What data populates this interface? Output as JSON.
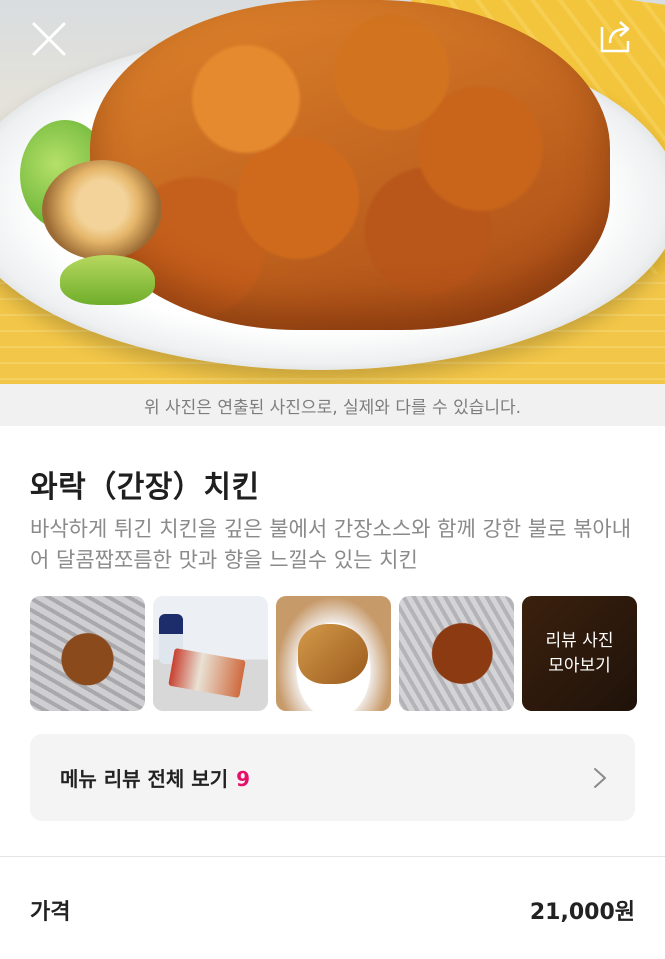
{
  "hero": {
    "close_icon": "close-icon",
    "share_icon": "share-icon"
  },
  "notice": "위 사진은 연출된 사진으로, 실제와 다를 수 있습니다.",
  "menu": {
    "title": "와락（간장）치킨",
    "description": "바삭하게 튀긴 치킨을 깊은 불에서 간장소스와 함께 강한 불로 볶아내어 달콤짭쪼름한 맛과 향을 느낄수 있는 치킨"
  },
  "review_photos": {
    "more_line1": "리뷰 사진",
    "more_line2": "모아보기"
  },
  "review_bar": {
    "label": "메뉴 리뷰 전체 보기",
    "count": "9",
    "count_color": "#e5106a"
  },
  "price": {
    "label": "가격",
    "value": "21,000원"
  }
}
